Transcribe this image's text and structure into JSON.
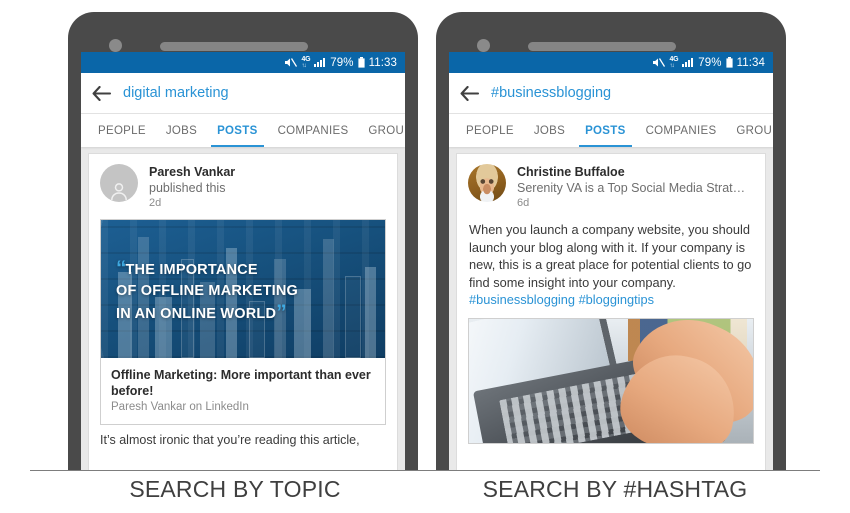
{
  "captions": {
    "left": "SEARCH BY TOPIC",
    "right": "SEARCH BY #HASHTAG"
  },
  "phones": {
    "left": {
      "status_bar": {
        "mute_icon": "mute-icon",
        "network_label": "4G",
        "signal_icon": "signal-bars-icon",
        "battery_percent": "79%",
        "battery_icon": "battery-icon",
        "time": "11:33"
      },
      "search": {
        "back_icon": "back-arrow-icon",
        "query": "digital marketing"
      },
      "tabs": [
        {
          "label": "PEOPLE",
          "active": false
        },
        {
          "label": "JOBS",
          "active": false
        },
        {
          "label": "POSTS",
          "active": true
        },
        {
          "label": "COMPANIES",
          "active": false
        },
        {
          "label": "GROU",
          "active": false
        }
      ],
      "post": {
        "avatar_icon": "person-placeholder-icon",
        "author_name": "Paresh Vankar",
        "author_subtitle": "published this",
        "time_ago": "2d",
        "hero_quote_line1": "THE IMPORTANCE",
        "hero_quote_line2": "OF OFFLINE MARKETING",
        "hero_quote_line3": "IN AN ONLINE WORLD",
        "quote_open": "“",
        "quote_close": "”",
        "article_title": "Offline Marketing: More important than ever before!",
        "article_source": "Paresh Vankar on LinkedIn",
        "article_snippet": "It’s almost ironic that you’re reading this article,"
      }
    },
    "right": {
      "status_bar": {
        "mute_icon": "mute-icon",
        "network_label": "4G",
        "signal_icon": "signal-bars-icon",
        "battery_percent": "79%",
        "battery_icon": "battery-icon",
        "time": "11:34"
      },
      "search": {
        "back_icon": "back-arrow-icon",
        "query": "#businessblogging"
      },
      "tabs": [
        {
          "label": "PEOPLE",
          "active": false
        },
        {
          "label": "JOBS",
          "active": false
        },
        {
          "label": "POSTS",
          "active": true
        },
        {
          "label": "COMPANIES",
          "active": false
        },
        {
          "label": "GROU",
          "active": false
        }
      ],
      "post": {
        "avatar_icon": "user-photo-avatar",
        "author_name": "Christine Buffaloe",
        "author_subtitle": "Serenity VA is a Top Social Media Strategi…",
        "time_ago": "6d",
        "body": "When you launch a company website, you should launch your blog along with it. If your company is new, this is a great place for potential clients to go find some insight into your company.",
        "hashtags": "#businessblogging #bloggingtips",
        "photo_alt": "hands-typing-on-laptop-photo"
      }
    }
  },
  "colors": {
    "status_bar": "#0a66a8",
    "link_blue": "#2a93d5",
    "phone_frame": "#4a4a4a",
    "feed_bg": "#e9e9e9",
    "quote_accent": "#3ea8e0"
  }
}
